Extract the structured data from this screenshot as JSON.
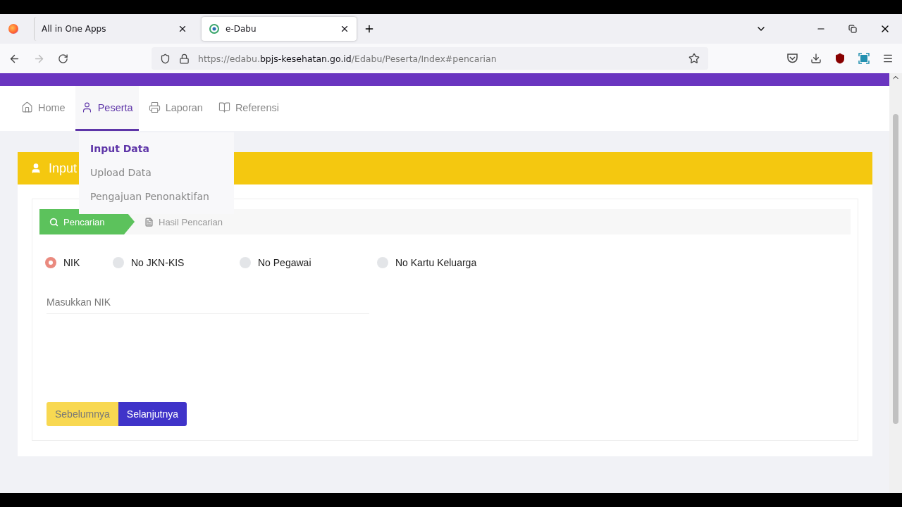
{
  "browser": {
    "tabs": [
      {
        "title": "All in One Apps",
        "selected": false
      },
      {
        "title": "e-Dabu",
        "selected": true
      }
    ],
    "url": {
      "prefix": "https://edabu.",
      "domain": "bpjs-kesehatan.go.id",
      "path": "/Edabu/Peserta/Index#pencarian"
    }
  },
  "nav": [
    {
      "label": "Home",
      "selected": false
    },
    {
      "label": "Peserta",
      "selected": true
    },
    {
      "label": "Laporan",
      "selected": false
    },
    {
      "label": "Referensi",
      "selected": false
    }
  ],
  "dropdown": [
    {
      "label": "Input Data",
      "selected": true
    },
    {
      "label": "Upload Data",
      "selected": false
    },
    {
      "label": "Pengajuan Penonaktifan",
      "selected": false
    }
  ],
  "header": {
    "title": "Input"
  },
  "steps": [
    {
      "label": "Pencarian",
      "selected": true
    },
    {
      "label": "Hasil Pencarian",
      "selected": false
    }
  ],
  "options": [
    {
      "label": "NIK",
      "selected": true
    },
    {
      "label": "No JKN-KIS",
      "selected": false
    },
    {
      "label": "No Pegawai",
      "selected": false
    },
    {
      "label": "No Kartu Keluarga",
      "selected": false
    }
  ],
  "field": {
    "placeholder": "Masukkan NIK"
  },
  "buttons": [
    {
      "label": "Sebelumnya",
      "kind": "prev"
    },
    {
      "label": "Selanjutnya",
      "kind": "next"
    }
  ]
}
